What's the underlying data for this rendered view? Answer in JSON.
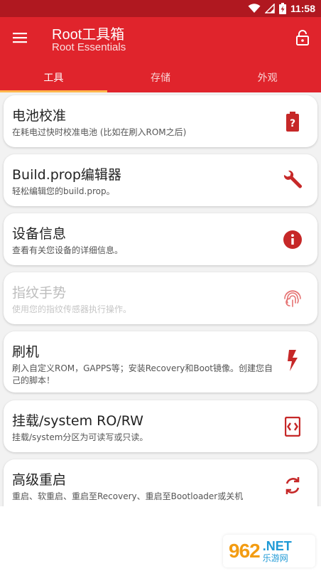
{
  "status_bar": {
    "time": "11:58"
  },
  "app_bar": {
    "title": "Root工具箱",
    "subtitle": "Root Essentials"
  },
  "tabs": [
    {
      "label": "工具",
      "active": true
    },
    {
      "label": "存储",
      "active": false
    },
    {
      "label": "外观",
      "active": false
    }
  ],
  "cards": [
    {
      "title": "电池校准",
      "desc": "在耗电过快时校准电池 (比如在刷入ROM之后)",
      "icon": "battery-unknown-icon",
      "enabled": true
    },
    {
      "title": "Build.prop编辑器",
      "desc": "轻松编辑您的build.prop。",
      "icon": "wrench-icon",
      "enabled": true
    },
    {
      "title": "设备信息",
      "desc": "查看有关您设备的详细信息。",
      "icon": "info-icon",
      "enabled": true
    },
    {
      "title": "指纹手势",
      "desc": "使用您的指纹传感器执行操作。",
      "icon": "fingerprint-icon",
      "enabled": false
    },
    {
      "title": "刷机",
      "desc": "刷入自定义ROM，GAPPS等；安装Recovery和Boot镜像。创建您自己的脚本！",
      "icon": "flash-icon",
      "enabled": true
    },
    {
      "title": "挂载/system RO/RW",
      "desc": "挂载/system分区为可读写或只读。",
      "icon": "mount-icon",
      "enabled": true
    },
    {
      "title": "高级重启",
      "desc": "重启、软重启、重启至Recovery、重启至Bootloader或关机",
      "icon": "restart-icon",
      "enabled": true
    }
  ],
  "watermark": {
    "logo": "962",
    "domain": ".NET",
    "name": "乐游网"
  },
  "colors": {
    "primary": "#e0242c",
    "status_bar": "#b01820",
    "accent": "#ffb74d",
    "icon": "#c62828"
  }
}
